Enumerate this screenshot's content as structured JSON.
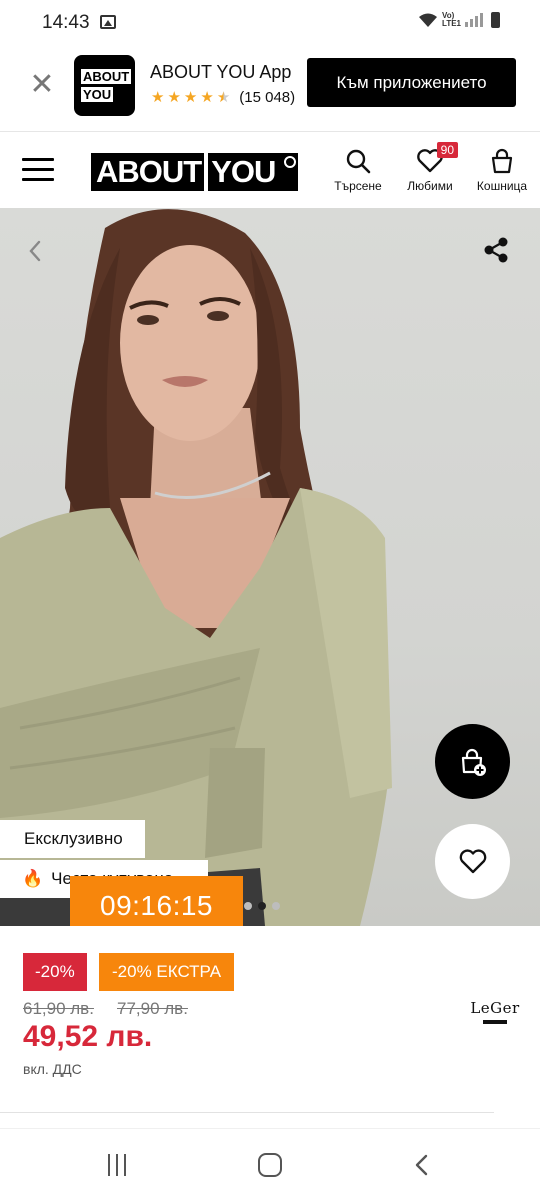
{
  "status_bar": {
    "time": "14:43",
    "network": "Vo)\nLTE1"
  },
  "app_banner": {
    "app_name": "ABOUT YOU App",
    "logo_line1": "ABOUT",
    "logo_line2": "YOU",
    "rating_stars": 4.5,
    "reviews": "(15 048)",
    "cta_label": "Към приложението"
  },
  "header": {
    "logo_word1": "ABOUT",
    "logo_word2": "YOU",
    "search_label": "Търсене",
    "favorites_label": "Любими",
    "favorites_count": "90",
    "cart_label": "Кошница"
  },
  "product": {
    "tags": [
      "Ексклузивно",
      "Често купувано"
    ],
    "carousel": {
      "count": 3,
      "active": 1
    },
    "countdown": "09:16:15",
    "discount_badge": "-20%",
    "extra_badge": "-20% ЕКСТРА",
    "old_price_1": "61,90 лв.",
    "old_price_2": "77,90 лв.",
    "current_price": "49,52 лв.",
    "vat_note": "вкл. ДДС",
    "brand": "LeGer"
  },
  "colors": {
    "sale_red": "#d7283a",
    "extra_orange": "#f7860c",
    "accent_black": "#000000"
  }
}
